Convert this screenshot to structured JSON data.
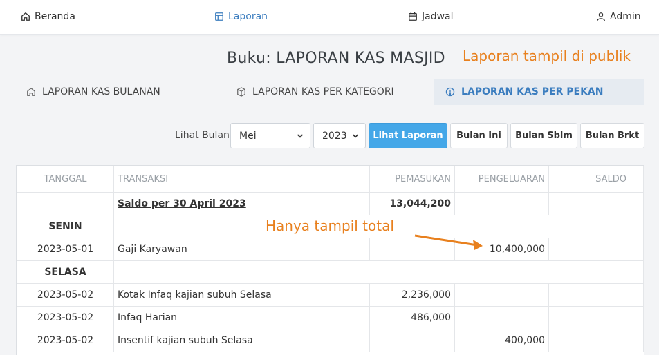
{
  "nav": {
    "home": "Beranda",
    "report": "Laporan",
    "schedule": "Jadwal",
    "admin": "Admin"
  },
  "title": "Buku: LAPORAN KAS MASJID",
  "annotations": {
    "public": "Laporan tampil di publik",
    "total_only": "Hanya tampil total"
  },
  "tabs": [
    {
      "label": "LAPORAN KAS BULANAN",
      "icon": "home-icon"
    },
    {
      "label": "LAPORAN KAS PER KATEGORI",
      "icon": "box-icon"
    },
    {
      "label": "LAPORAN KAS PER PEKAN",
      "icon": "info-circle-icon",
      "active": true
    }
  ],
  "filter": {
    "label": "Lihat Bulan",
    "month": "Mei",
    "year": "2023",
    "view_button": "Lihat Laporan",
    "this_month": "Bulan Ini",
    "prev_month": "Bulan Sblm",
    "next_month": "Bulan Brkt"
  },
  "table": {
    "headers": [
      "TANGGAL",
      "TRANSAKSI",
      "PEMASUKAN",
      "PENGELUARAN",
      "SALDO"
    ],
    "opening": {
      "label": "Saldo per 30 April 2023",
      "income": "13,044,200"
    },
    "days": [
      {
        "name": "SENIN",
        "rows": [
          {
            "date": "2023-05-01",
            "trans": "Gaji Karyawan",
            "income": "",
            "expense": "10,400,000"
          }
        ]
      },
      {
        "name": "SELASA",
        "rows": [
          {
            "date": "2023-05-02",
            "trans": "Kotak Infaq kajian subuh Selasa",
            "income": "2,236,000",
            "expense": ""
          },
          {
            "date": "2023-05-02",
            "trans": "Infaq Harian",
            "income": "486,000",
            "expense": ""
          },
          {
            "date": "2023-05-02",
            "trans": "Insentif kajian subuh Selasa",
            "income": "",
            "expense": "400,000"
          }
        ]
      }
    ]
  },
  "colors": {
    "accent": "#3b7dbf",
    "primary_button": "#44a7e8",
    "annotation": "#e8801e"
  }
}
